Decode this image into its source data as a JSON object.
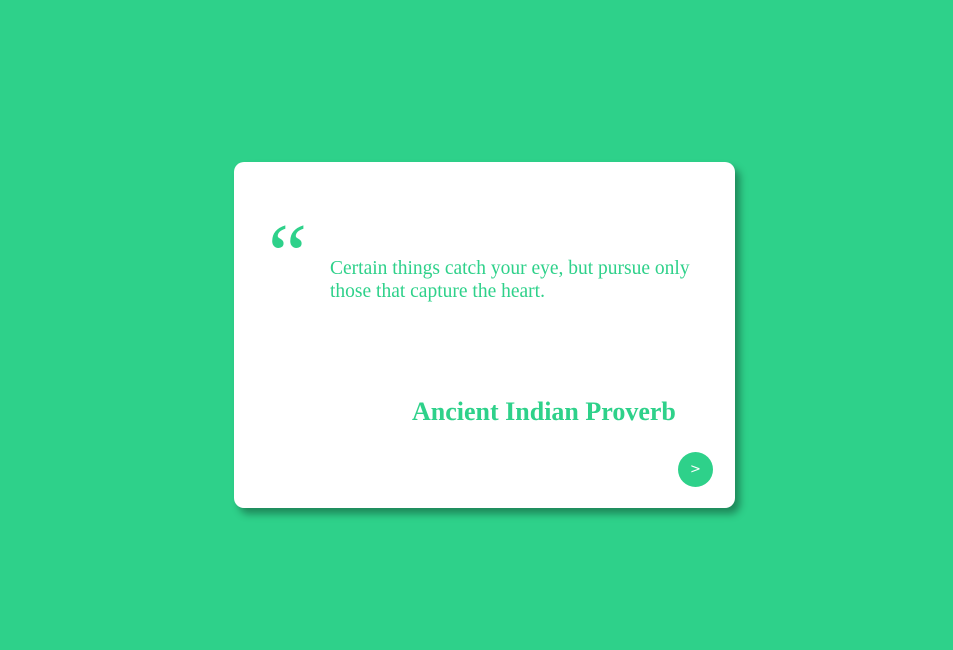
{
  "theme": {
    "background_color": "#2ed18a",
    "card_color": "#ffffff",
    "accent_color": "#2ed18a"
  },
  "quote": {
    "mark": "“",
    "text": "Certain things catch your eye, but pursue only those that capture the heart.",
    "author": "Ancient Indian Proverb"
  },
  "controls": {
    "next_label": ">"
  }
}
